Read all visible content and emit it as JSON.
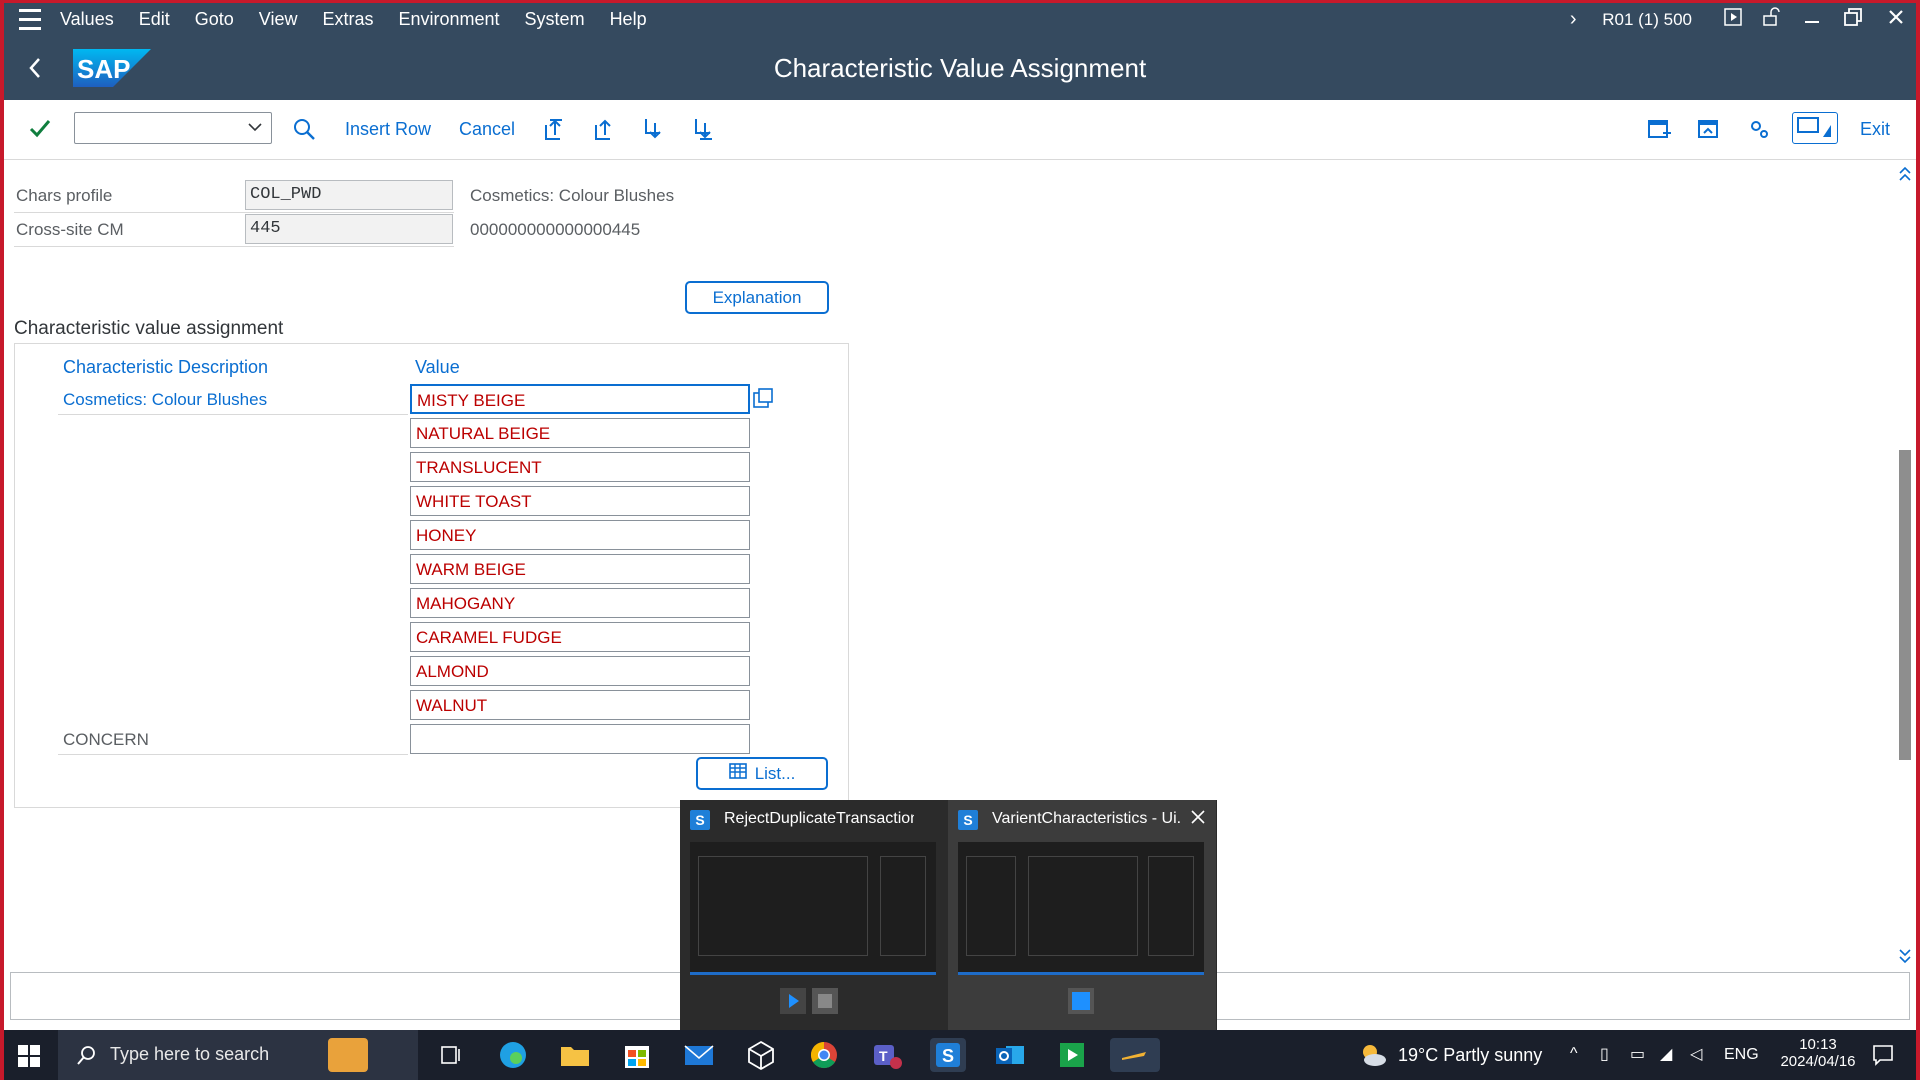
{
  "menu": {
    "items": [
      "Values",
      "Edit",
      "Goto",
      "View",
      "Extras",
      "Environment",
      "System",
      "Help"
    ],
    "system_info": "R01 (1) 500"
  },
  "header": {
    "title": "Characteristic Value Assignment",
    "logo_text": "SAP"
  },
  "toolbar": {
    "insert_row": "Insert Row",
    "cancel": "Cancel",
    "exit": "Exit",
    "command_field": ""
  },
  "form": {
    "chars_profile_label": "Chars profile",
    "chars_profile_value": "COL_PWD",
    "chars_profile_desc": "Cosmetics: Colour Blushes",
    "cross_site_label": "Cross-site CM",
    "cross_site_value": "445",
    "cross_site_desc": "000000000000000445",
    "explanation_button": "Explanation"
  },
  "assignment": {
    "section_title": "Characteristic value assignment",
    "col_description": "Characteristic Description",
    "col_value": "Value",
    "characteristic_1": "Cosmetics: Colour Blushes",
    "values": [
      "MISTY BEIGE",
      "NATURAL BEIGE",
      "TRANSLUCENT",
      "WHITE TOAST",
      "HONEY",
      "WARM BEIGE",
      "MAHOGANY",
      "CARAMEL FUDGE",
      "ALMOND",
      "WALNUT"
    ],
    "characteristic_2": "CONCERN",
    "concern_value": "",
    "list_button": "List..."
  },
  "previews": [
    {
      "title": "RejectDuplicateTransactions - ..."
    },
    {
      "title": "VarientCharacteristics - Ui..."
    }
  ],
  "taskbar": {
    "search_placeholder": "Type here to search",
    "weather": "19°C  Partly sunny",
    "language": "ENG",
    "time": "10:13",
    "date": "2024/04/16"
  },
  "colors": {
    "shell": "#354a5f",
    "accent": "#0a6ed1",
    "value_text": "#bb0000",
    "frame": "#c7192b"
  }
}
